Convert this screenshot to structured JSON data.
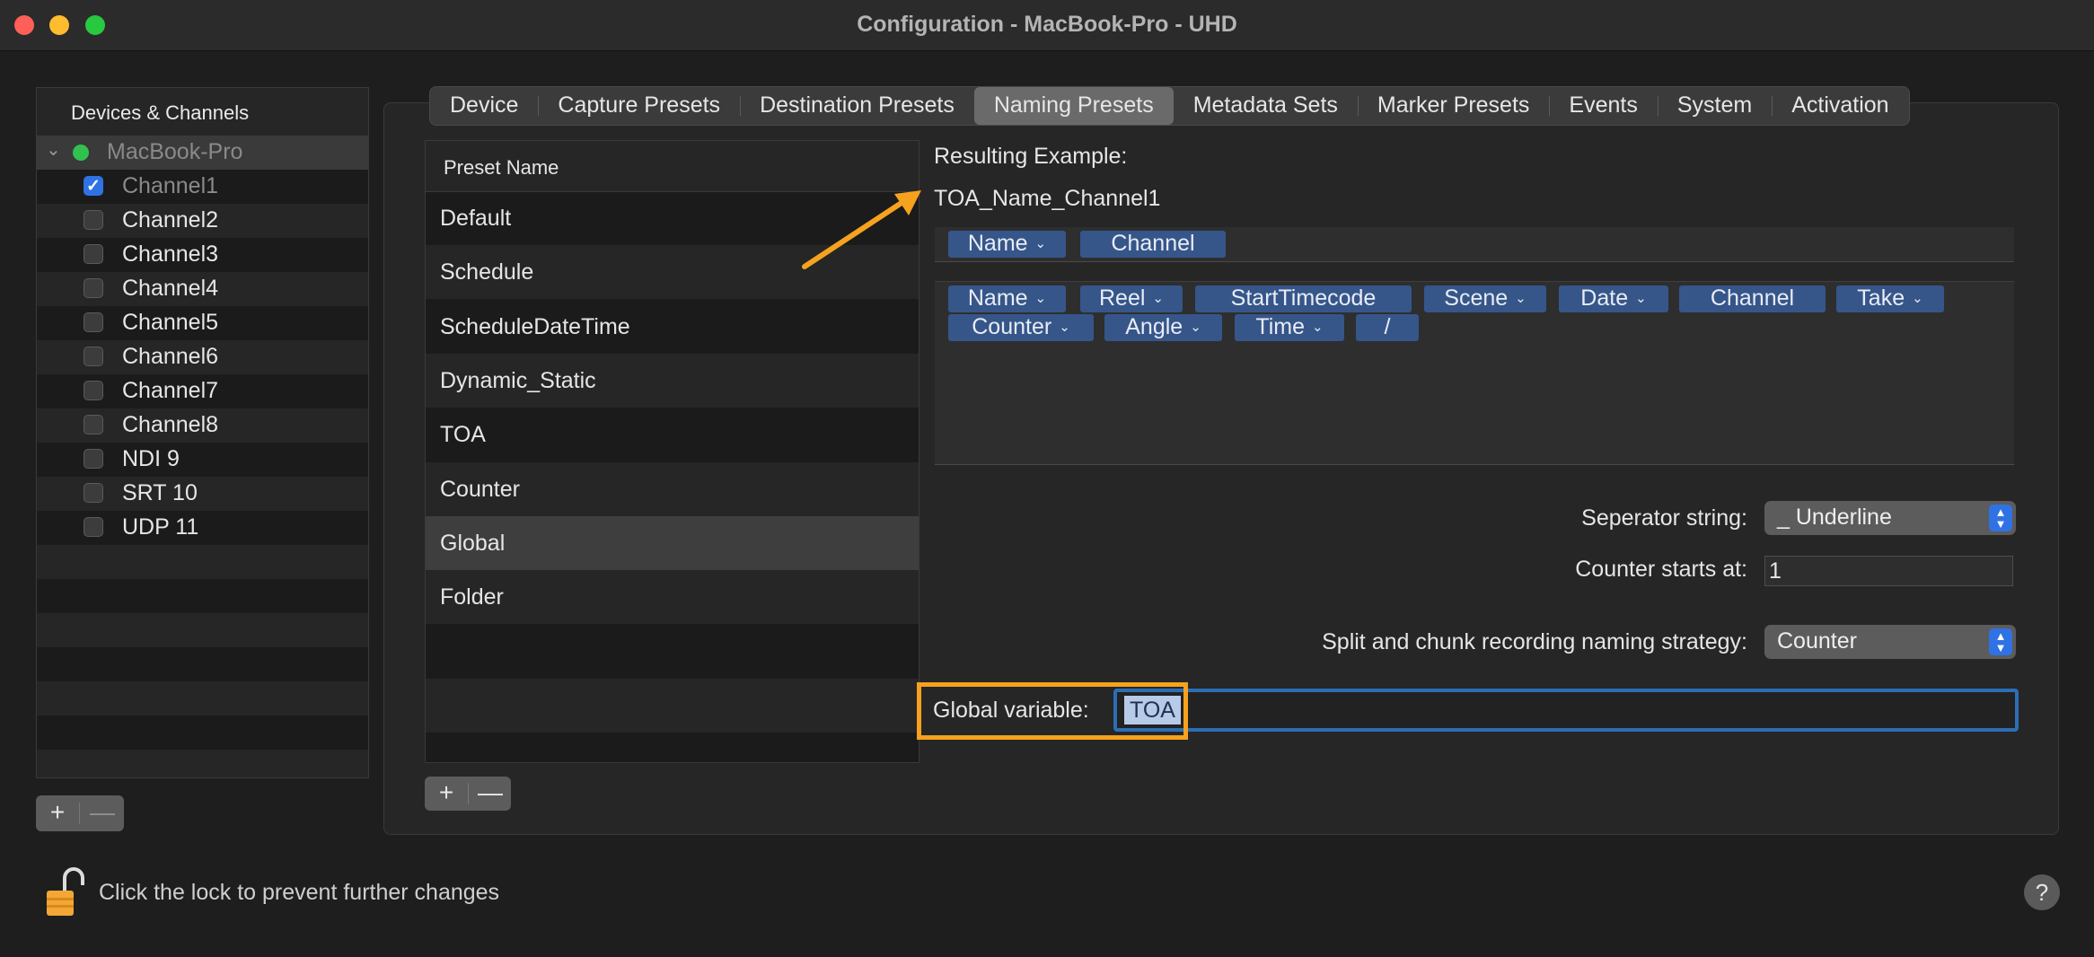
{
  "window": {
    "title": "Configuration - MacBook-Pro - UHD"
  },
  "sidebar": {
    "header": "Devices & Channels",
    "device": {
      "name": "MacBook-Pro",
      "status_color": "#31c14e"
    },
    "channels": [
      {
        "label": "Channel1",
        "checked": true
      },
      {
        "label": "Channel2",
        "checked": false
      },
      {
        "label": "Channel3",
        "checked": false
      },
      {
        "label": "Channel4",
        "checked": false
      },
      {
        "label": "Channel5",
        "checked": false
      },
      {
        "label": "Channel6",
        "checked": false
      },
      {
        "label": "Channel7",
        "checked": false
      },
      {
        "label": "Channel8",
        "checked": false
      },
      {
        "label": "NDI 9",
        "checked": false
      },
      {
        "label": "SRT 10",
        "checked": false
      },
      {
        "label": "UDP 11",
        "checked": false
      }
    ],
    "add_label": "+",
    "remove_label": "—"
  },
  "tabs": [
    {
      "label": "Device"
    },
    {
      "label": "Capture Presets"
    },
    {
      "label": "Destination Presets"
    },
    {
      "label": "Naming Presets",
      "active": true
    },
    {
      "label": "Metadata Sets"
    },
    {
      "label": "Marker Presets"
    },
    {
      "label": "Events"
    },
    {
      "label": "System"
    },
    {
      "label": "Activation"
    }
  ],
  "presets": {
    "header": "Preset Name",
    "items": [
      "Default",
      "Schedule",
      "ScheduleDateTime",
      "Dynamic_Static",
      "TOA",
      "Counter",
      "Global",
      "Folder"
    ],
    "selected": "Global",
    "add_label": "+",
    "remove_label": "—"
  },
  "naming": {
    "resulting_label": "Resulting Example:",
    "resulting_value": "TOA_Name_Channel1",
    "selected_tokens": [
      "Name",
      "Channel"
    ],
    "available_tokens_row1": [
      "Name",
      "Reel",
      "StartTimecode",
      "Scene",
      "Date",
      "Channel",
      "Take"
    ],
    "available_tokens_row2": [
      "Counter",
      "Angle",
      "Time",
      "/"
    ],
    "separator_label": "Seperator string:",
    "separator_value": "_ Underline",
    "counter_label": "Counter starts at:",
    "counter_value": "1",
    "split_label": "Split and chunk recording naming strategy:",
    "split_value": "Counter",
    "global_label": "Global variable:",
    "global_value": "TOA"
  },
  "footer": {
    "lock_text": "Click the lock to prevent further changes",
    "help_label": "?"
  },
  "colors": {
    "annotation": "#f6a21e",
    "accent": "#2f72e4",
    "token": "#36568a"
  }
}
